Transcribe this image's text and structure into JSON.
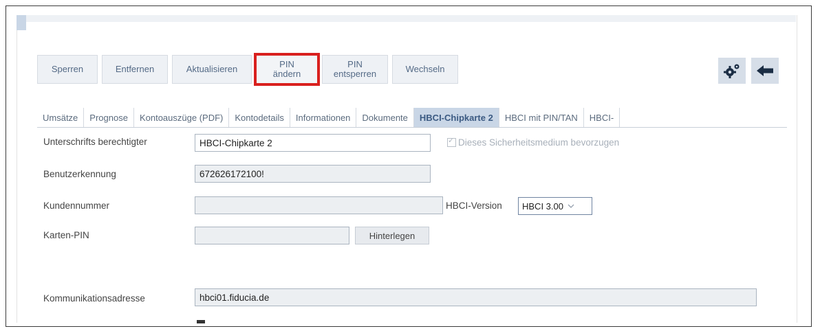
{
  "toolbar": {
    "buttons": [
      {
        "label": "Sperren"
      },
      {
        "label": "Entfernen"
      },
      {
        "label": "Aktualisieren"
      },
      {
        "line1": "PIN",
        "line2": "ändern",
        "highlight_color": "#d9201e"
      },
      {
        "line1": "PIN",
        "line2": "entsperren"
      },
      {
        "label": "Wechseln"
      }
    ],
    "icons": [
      "settings-gears-icon",
      "back-arrow-icon"
    ]
  },
  "tabs": [
    {
      "label": "Umsätze"
    },
    {
      "label": "Prognose"
    },
    {
      "label": "Kontoauszüge (PDF)"
    },
    {
      "label": "Kontodetails"
    },
    {
      "label": "Informationen"
    },
    {
      "label": "Dokumente"
    },
    {
      "label": "HBCI-Chipkarte 2",
      "active": true
    },
    {
      "label": "HBCI mit PIN/TAN"
    },
    {
      "label": "HBCI-"
    }
  ],
  "form": {
    "signer_label": "Unterschrifts berechtigter",
    "signer_value": "HBCI-Chipkarte 2",
    "prefer_label": "Dieses Sicherheitsmedium bevorzugen",
    "user_id_label": "Benutzerkennung",
    "user_id_value": "672626172100!",
    "customer_no_label": "Kundennummer",
    "customer_no_value": "",
    "hbci_version_label": "HBCI-Version",
    "hbci_version_value": "HBCI 3.00",
    "card_pin_label": "Karten-PIN",
    "card_pin_value": "",
    "store_button": "Hinterlegen",
    "comm_address_label": "Kommunikationsadresse",
    "comm_address_value": "hbci01.fiducia.de"
  },
  "colors": {
    "accent": "#c9d6e6",
    "button_bg": "#eef1f5",
    "highlight": "#d9201e",
    "icon_dark": "#1b2d44"
  }
}
